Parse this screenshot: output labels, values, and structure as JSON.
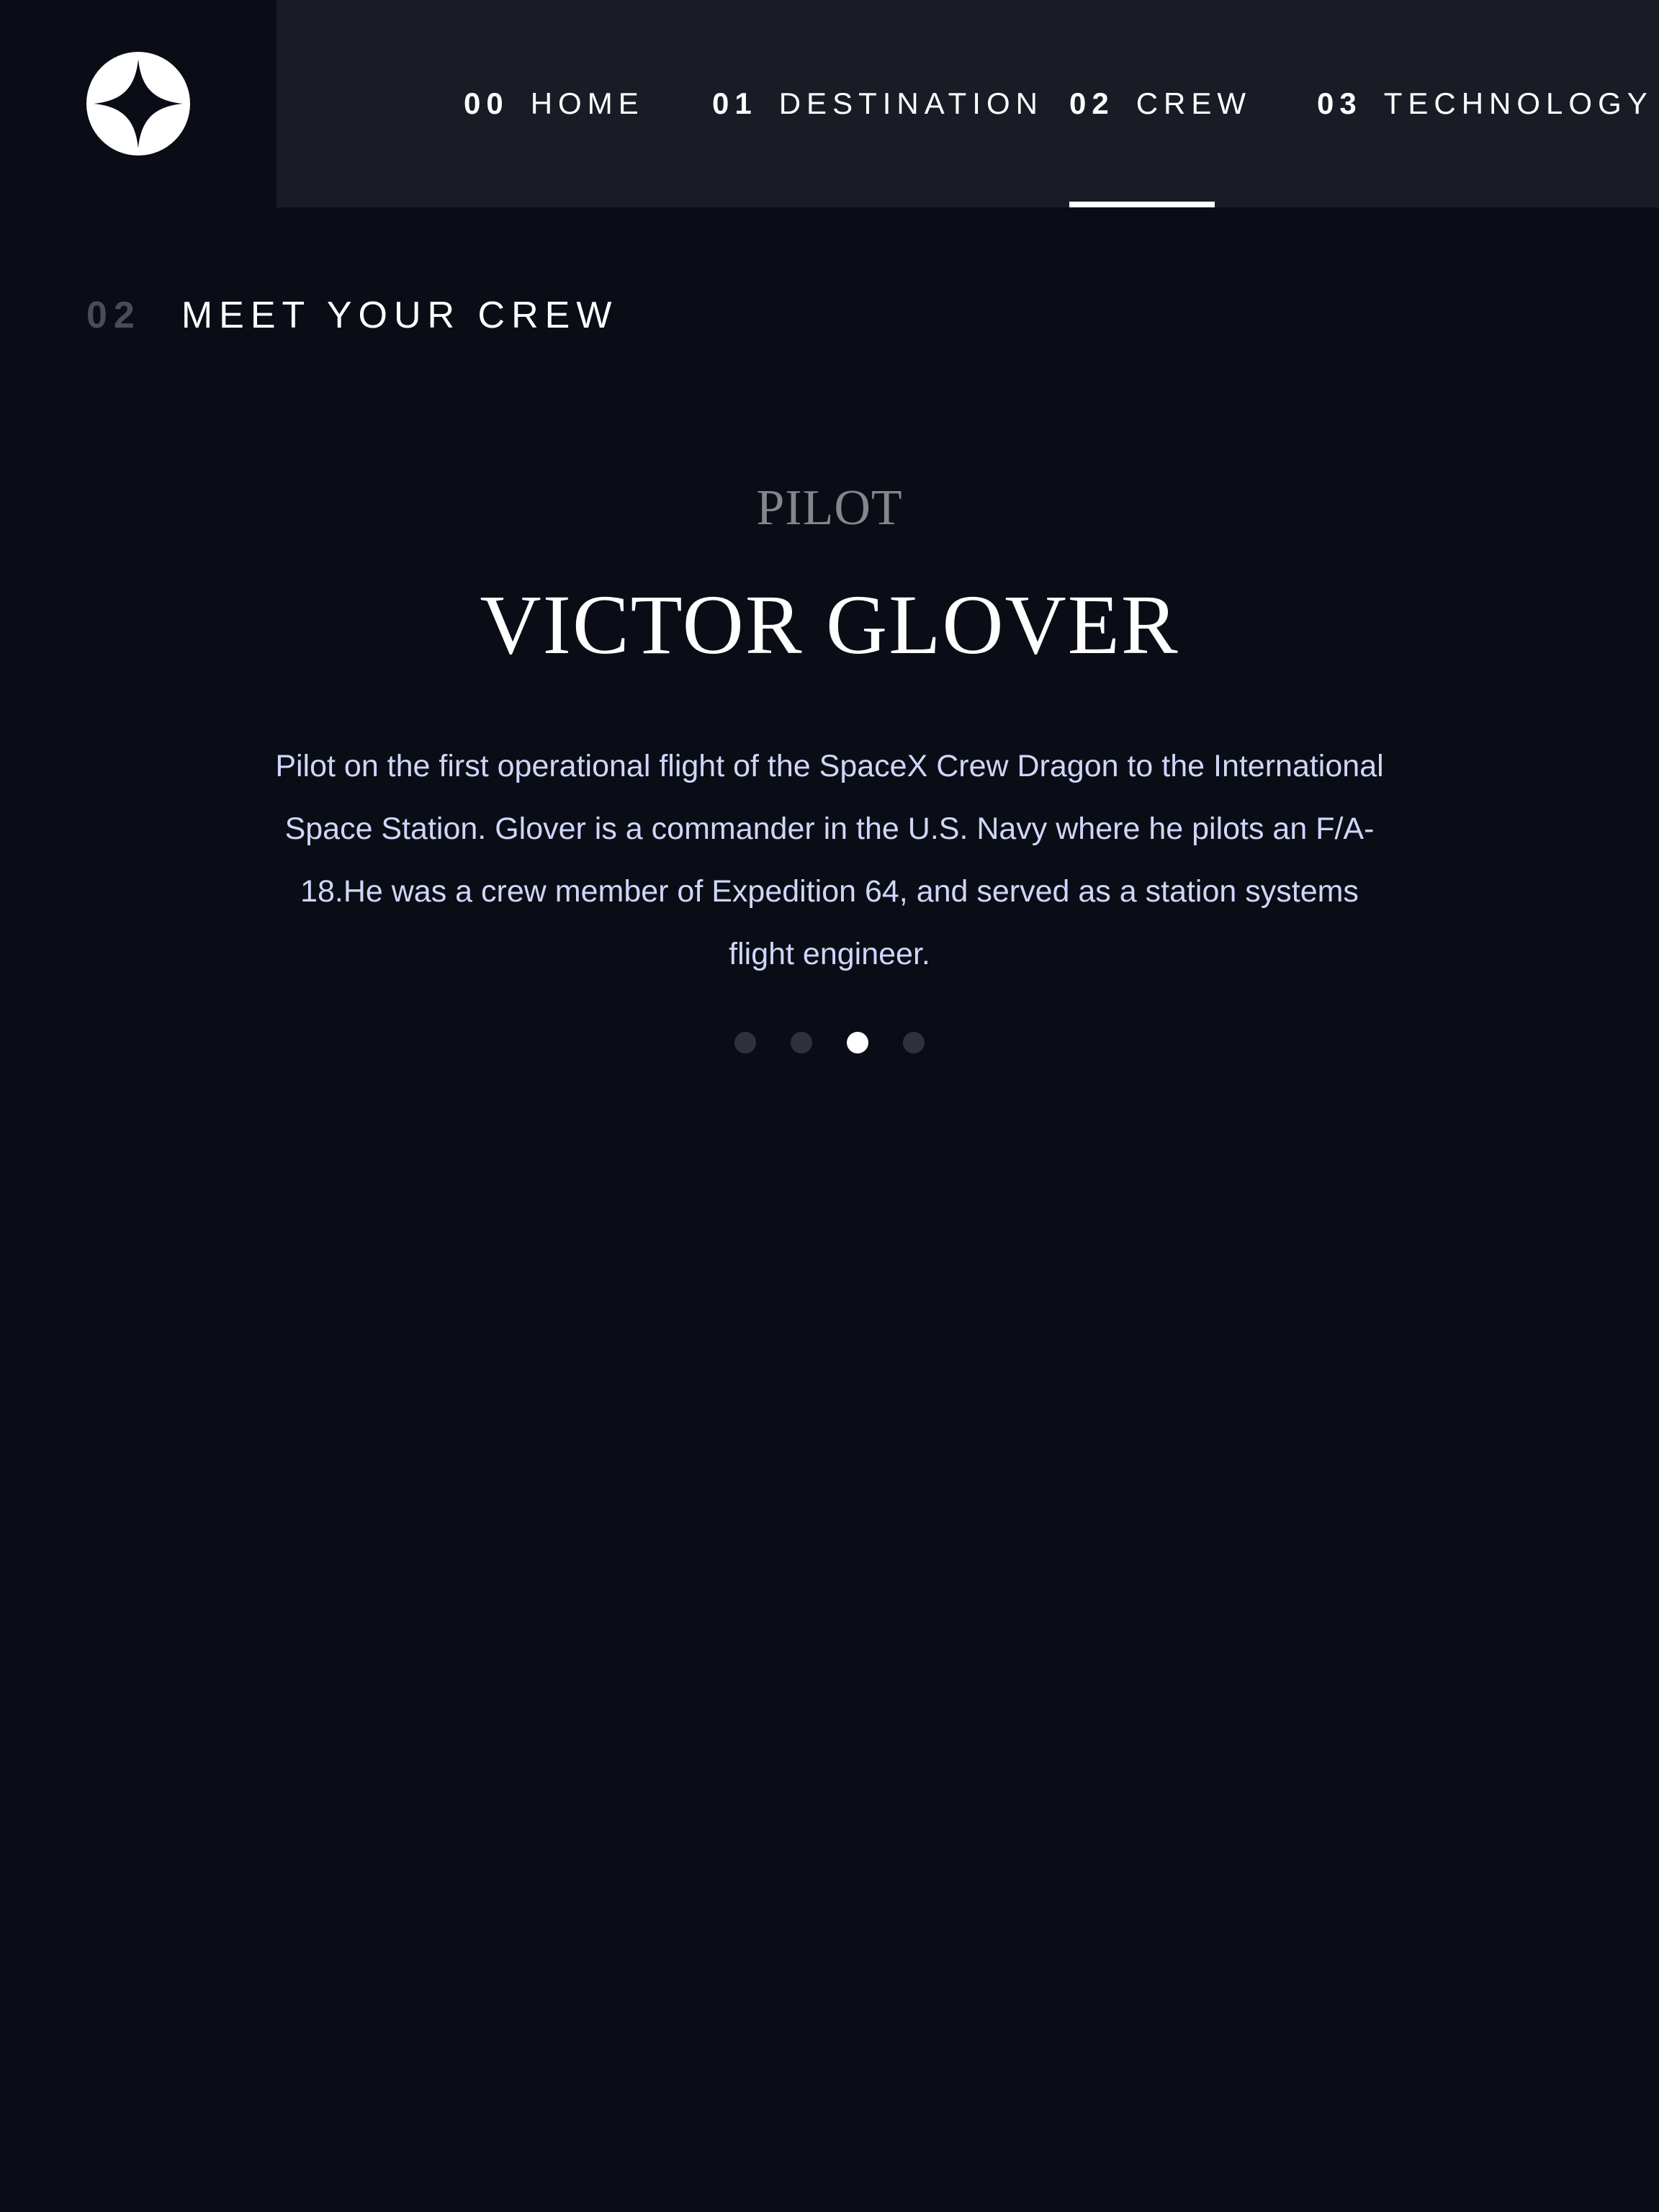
{
  "header": {
    "logo_icon": "star-logo-icon",
    "nav": {
      "home": {
        "number": "00",
        "label": "HOME"
      },
      "destination": {
        "number": "01",
        "label": "DESTINATION"
      },
      "crew": {
        "number": "02",
        "label": "CREW"
      },
      "technology": {
        "number": "03",
        "label": "TECHNOLOGY"
      }
    },
    "active_nav": "crew"
  },
  "page": {
    "number": "02",
    "title": "MEET YOUR CREW"
  },
  "crew": {
    "role": "PILOT",
    "name": "VICTOR GLOVER",
    "bio": "Pilot on the first operational flight of the SpaceX Crew Dragon to the International Space Station. Glover is a commander in the U.S. Navy where he pilots an F/A-18.He was a crew member of Expedition 64, and served as a station systems flight engineer."
  },
  "carousel": {
    "total": 4,
    "active_index": 3
  },
  "colors": {
    "background": "#0b0d16",
    "nav_background": "#191c24",
    "accent": "#ffffff",
    "muted": "#85868c",
    "body_text": "#d0d6f9",
    "inactive_dot": "#2f323b"
  }
}
